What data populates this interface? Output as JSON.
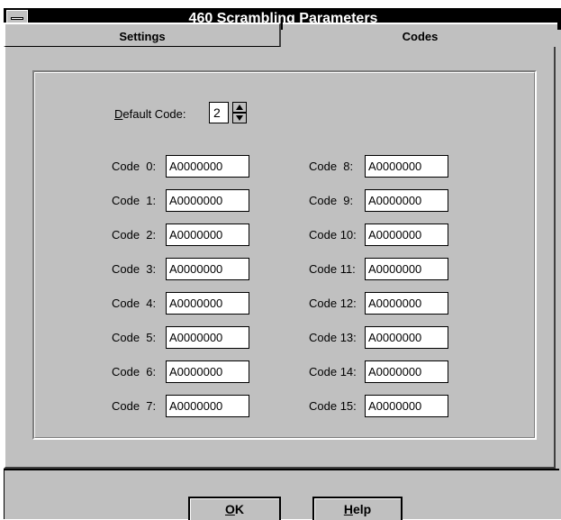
{
  "window": {
    "title": "460 Scrambling Parameters"
  },
  "tabs": [
    {
      "label": "Settings",
      "active": false
    },
    {
      "label": "Codes",
      "active": true
    }
  ],
  "default_code": {
    "label_accel": "D",
    "label_rest": "efault Code:",
    "value": "2"
  },
  "codes_left": [
    {
      "label": "Code  0:",
      "value": "A0000000"
    },
    {
      "label": "Code  1:",
      "value": "A0000000"
    },
    {
      "label": "Code  2:",
      "value": "A0000000"
    },
    {
      "label": "Code  3:",
      "value": "A0000000"
    },
    {
      "label": "Code  4:",
      "value": "A0000000"
    },
    {
      "label": "Code  5:",
      "value": "A0000000"
    },
    {
      "label": "Code  6:",
      "value": "A0000000"
    },
    {
      "label": "Code  7:",
      "value": "A0000000"
    }
  ],
  "codes_right": [
    {
      "label": "Code  8:",
      "value": "A0000000"
    },
    {
      "label": "Code  9:",
      "value": "A0000000"
    },
    {
      "label": "Code 10:",
      "value": "A0000000"
    },
    {
      "label": "Code 11:",
      "value": "A0000000"
    },
    {
      "label": "Code 12:",
      "value": "A0000000"
    },
    {
      "label": "Code 13:",
      "value": "A0000000"
    },
    {
      "label": "Code 14:",
      "value": "A0000000"
    },
    {
      "label": "Code 15:",
      "value": "A0000000"
    }
  ],
  "buttons": {
    "ok_accel": "O",
    "ok_rest": "K",
    "help_accel": "H",
    "help_rest": "elp"
  },
  "icons": {
    "system_menu": "system-menu-icon",
    "spinner_up": "arrow-up-icon",
    "spinner_down": "arrow-down-icon"
  }
}
